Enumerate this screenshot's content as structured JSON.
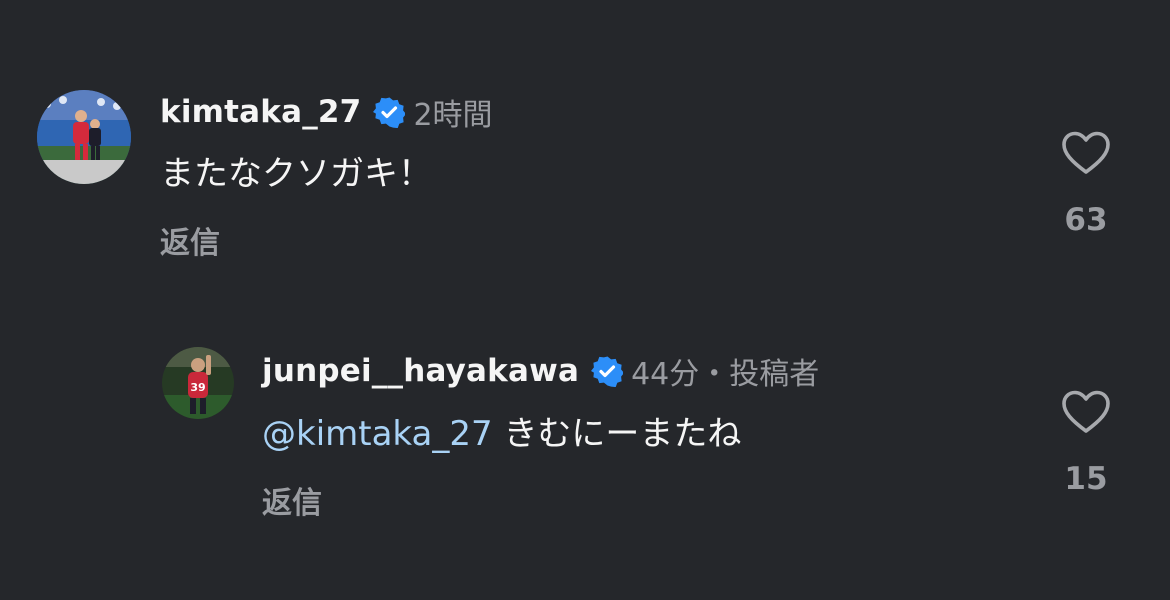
{
  "comments": [
    {
      "username": "kimtaka_27",
      "verified": true,
      "meta": "2時間",
      "mention": "",
      "text": "またなクソガキ！",
      "reply_label": "返信",
      "likes": "63",
      "avatar_icon": "soccer-player-avatar"
    },
    {
      "username": "junpei__hayakawa",
      "verified": true,
      "meta": "44分・投稿者",
      "mention": "@kimtaka_27",
      "text": "きむにーまたね",
      "reply_label": "返信",
      "likes": "15",
      "avatar_icon": "soccer-player-avatar"
    }
  ],
  "colors": {
    "background": "#25272b",
    "verified": "#2c8ef8",
    "mention": "#a9d2f5",
    "secondary_text": "#9a9ca1",
    "primary_text": "#f5f5f5"
  }
}
